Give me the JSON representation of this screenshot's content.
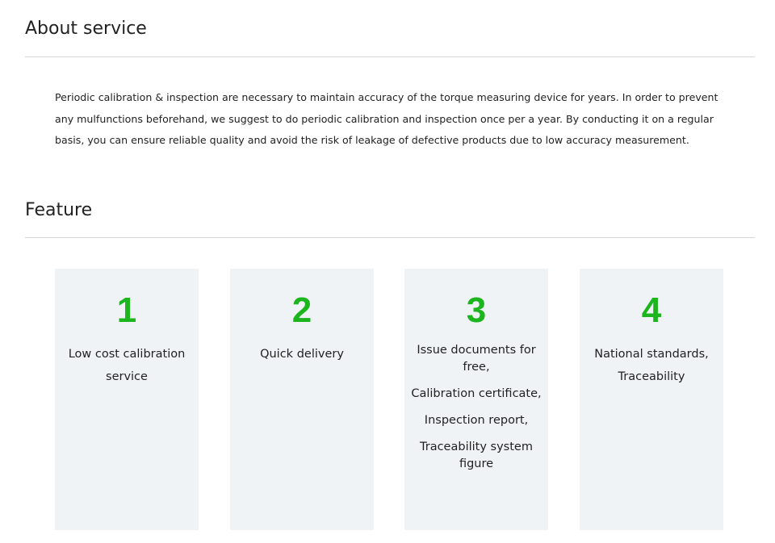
{
  "about": {
    "title": "About service",
    "body": "Periodic calibration & inspection are necessary to maintain accuracy of the torque measuring device for years. In order to prevent any mulfunctions beforehand, we suggest to do periodic calibration and inspection once per a year. By conducting it on a regular basis, you can ensure reliable quality and avoid the risk of leakage of defective products due to low accuracy measurement."
  },
  "feature": {
    "title": "Feature",
    "accent_color": "#1db51d",
    "card_background": "#eff3f6",
    "cards": [
      {
        "number": "1",
        "text": "Low cost calibration service"
      },
      {
        "number": "2",
        "text": "Quick delivery"
      },
      {
        "number": "3",
        "lines": [
          "Issue documents for free,",
          "Calibration certificate,",
          "Inspection report,",
          "Traceability system figure"
        ]
      },
      {
        "number": "4",
        "text": "National standards, Traceability"
      }
    ]
  }
}
